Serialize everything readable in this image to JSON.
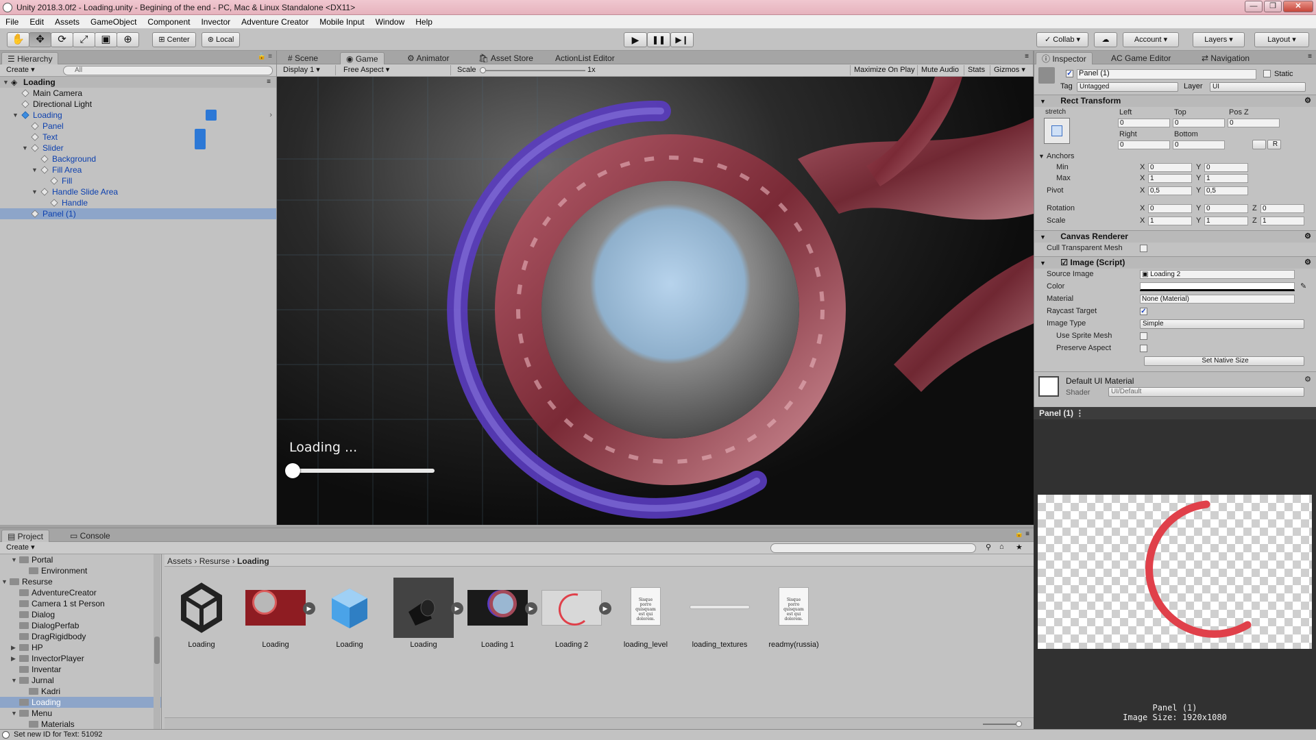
{
  "window": {
    "title": "Unity 2018.3.0f2 - Loading.unity - Begining of the end - PC, Mac & Linux Standalone <DX11>",
    "controls": [
      "—",
      "❐",
      "✕"
    ]
  },
  "menu": [
    "File",
    "Edit",
    "Assets",
    "GameObject",
    "Component",
    "Invector",
    "Adventure Creator",
    "Mobile Input",
    "Window",
    "Help"
  ],
  "toolbar": {
    "pivot_mode": "Center",
    "pivot_space": "Local",
    "collab": "Collab",
    "account": "Account",
    "layers": "Layers",
    "layout": "Layout"
  },
  "hierarchy": {
    "tab": "Hierarchy",
    "create": "Create",
    "search_placeholder": "All",
    "scene": "Loading",
    "items": [
      {
        "label": "Main Camera"
      },
      {
        "label": "Directional Light"
      },
      {
        "label": "Loading"
      },
      {
        "label": "Panel"
      },
      {
        "label": "Text"
      },
      {
        "label": "Slider"
      },
      {
        "label": "Background"
      },
      {
        "label": "Fill Area"
      },
      {
        "label": "Fill"
      },
      {
        "label": "Handle Slide Area"
      },
      {
        "label": "Handle"
      },
      {
        "label": "Panel (1)"
      }
    ]
  },
  "center": {
    "tabs": [
      "Scene",
      "Game",
      "Animator",
      "Asset Store",
      "ActionList Editor"
    ],
    "display": "Display 1",
    "aspect": "Free Aspect",
    "scale_label": "Scale",
    "scale_value": "1x",
    "maximize": "Maximize On Play",
    "mute": "Mute Audio",
    "stats": "Stats",
    "gizmos": "Gizmos",
    "loading_text": "Loading ...",
    "slider_value": 0
  },
  "inspector": {
    "tabs": [
      "Inspector",
      "AC Game Editor",
      "Navigation"
    ],
    "object_name": "Panel (1)",
    "static_label": "Static",
    "tag_label": "Tag",
    "tag_value": "Untagged",
    "layer_label": "Layer",
    "layer_value": "UI",
    "rect_transform": {
      "title": "Rect Transform",
      "anchor_preset": "stretch",
      "left_label": "Left",
      "left": "0",
      "top_label": "Top",
      "top": "0",
      "posz_label": "Pos Z",
      "posz": "0",
      "right_label": "Right",
      "right": "0",
      "bottom_label": "Bottom",
      "bottom": "0",
      "blueprint_btn": "",
      "raw_btn": "R",
      "anchors_label": "Anchors",
      "min_label": "Min",
      "min_x": "0",
      "min_y": "0",
      "max_label": "Max",
      "max_x": "1",
      "max_y": "1",
      "pivot_label": "Pivot",
      "pivot_x": "0,5",
      "pivot_y": "0,5",
      "rotation_label": "Rotation",
      "rot_x": "0",
      "rot_y": "0",
      "rot_z": "0",
      "scale_label": "Scale",
      "scale_x": "1",
      "scale_y": "1",
      "scale_z": "1",
      "x": "X",
      "y": "Y",
      "z": "Z"
    },
    "canvas_renderer": {
      "title": "Canvas Renderer",
      "cull_label": "Cull Transparent Mesh"
    },
    "image": {
      "title": "Image (Script)",
      "source_label": "Source Image",
      "source_value": "Loading 2",
      "color_label": "Color",
      "material_label": "Material",
      "material_value": "None (Material)",
      "raycast_label": "Raycast Target",
      "type_label": "Image Type",
      "type_value": "Simple",
      "sprite_mesh_label": "Use Sprite Mesh",
      "preserve_label": "Preserve Aspect",
      "native_btn": "Set Native Size"
    },
    "material": {
      "name": "Default UI Material",
      "shader_label": "Shader",
      "shader_value": "UI/Default"
    }
  },
  "preview": {
    "header": "Panel (1)",
    "name": "Panel (1)",
    "size": "Image Size: 1920x1080"
  },
  "project": {
    "tabs": [
      "Project",
      "Console"
    ],
    "create": "Create",
    "breadcrumb": [
      "Assets",
      "Resurse",
      "Loading"
    ],
    "tree": [
      {
        "label": "Portal",
        "indent": 2,
        "arrow": "▼"
      },
      {
        "label": "Environment",
        "indent": 3,
        "arrow": ""
      },
      {
        "label": "Resurse",
        "indent": 1,
        "arrow": "▼"
      },
      {
        "label": "AdventureCreator",
        "indent": 2,
        "arrow": ""
      },
      {
        "label": "Camera 1 st Person",
        "indent": 2,
        "arrow": ""
      },
      {
        "label": "Dialog",
        "indent": 2,
        "arrow": ""
      },
      {
        "label": "DialogPerfab",
        "indent": 2,
        "arrow": ""
      },
      {
        "label": "DragRigidbody",
        "indent": 2,
        "arrow": ""
      },
      {
        "label": "HP",
        "indent": 2,
        "arrow": "▶"
      },
      {
        "label": "InvectorPlayer",
        "indent": 2,
        "arrow": "▶"
      },
      {
        "label": "Inventar",
        "indent": 2,
        "arrow": ""
      },
      {
        "label": "Jurnal",
        "indent": 2,
        "arrow": "▼"
      },
      {
        "label": "Kadri",
        "indent": 3,
        "arrow": ""
      },
      {
        "label": "Loading",
        "indent": 2,
        "arrow": ""
      },
      {
        "label": "Menu",
        "indent": 2,
        "arrow": "▼"
      },
      {
        "label": "Materials",
        "indent": 3,
        "arrow": ""
      }
    ],
    "assets": [
      {
        "label": "Loading",
        "kind": "unity-scene-icon"
      },
      {
        "label": "Loading",
        "kind": "texture-icon"
      },
      {
        "label": "Loading",
        "kind": "prefab-icon"
      },
      {
        "label": "Loading",
        "kind": "dark-texture-icon"
      },
      {
        "label": "Loading 1",
        "kind": "texture-icon"
      },
      {
        "label": "Loading 2",
        "kind": "arc-sprite-icon"
      },
      {
        "label": "loading_level",
        "kind": "document-icon"
      },
      {
        "label": "loading_textures",
        "kind": "line-icon"
      },
      {
        "label": "readmy(russia)",
        "kind": "document-icon"
      }
    ],
    "doc_thumb_text": "Sisque porro quisquam est qui dolorem."
  },
  "status": "Set new ID for Text: 51092"
}
